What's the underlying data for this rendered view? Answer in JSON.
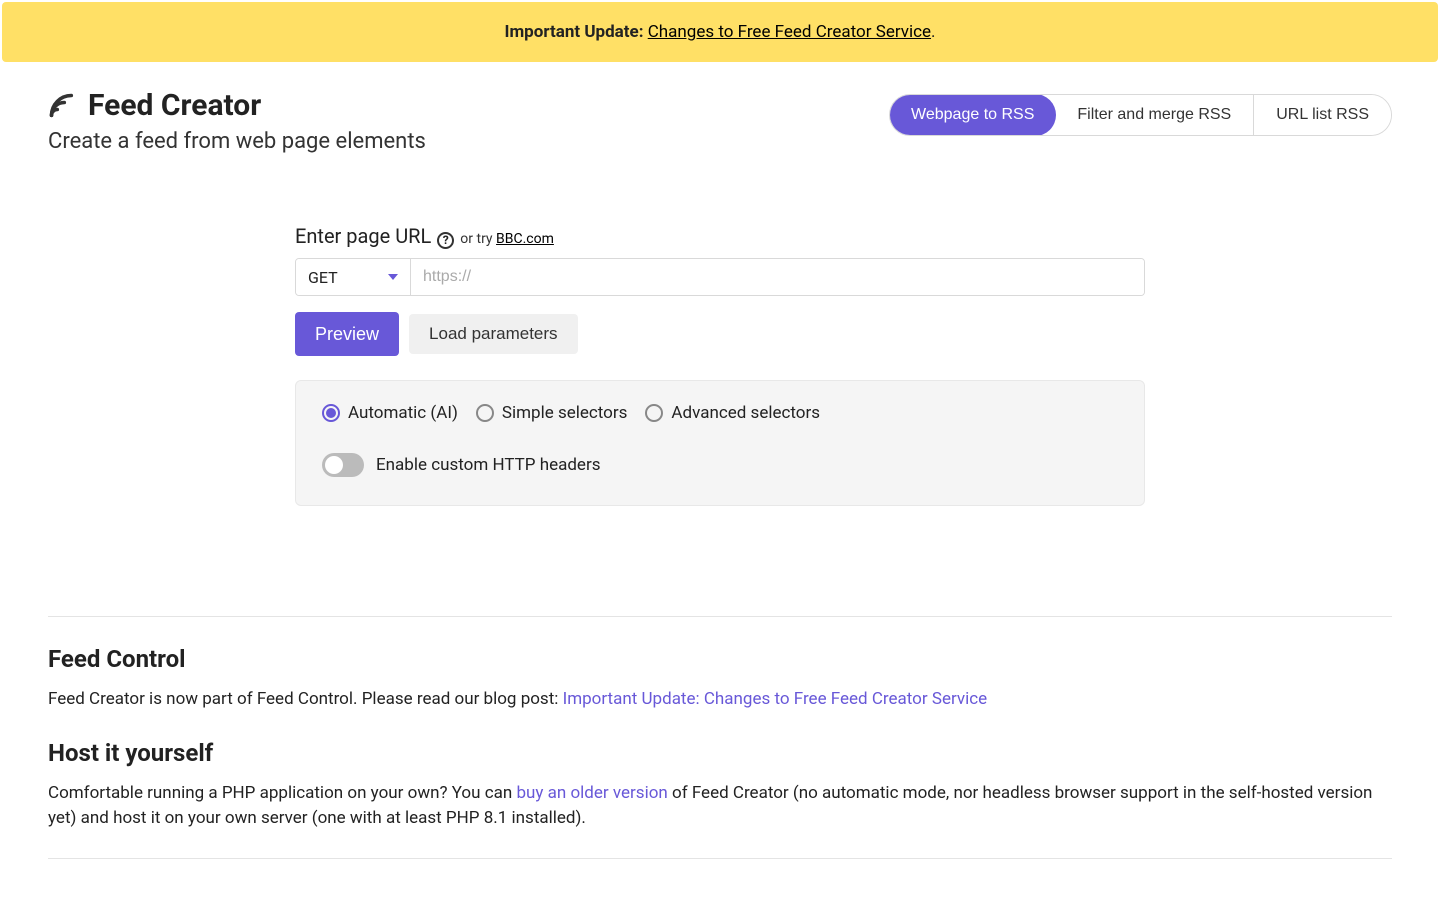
{
  "banner": {
    "prefix": "Important Update:",
    "link_text": "Changes to Free Feed Creator Service",
    "suffix": "."
  },
  "header": {
    "title": "Feed Creator",
    "subtitle": "Create a feed from web page elements"
  },
  "tabs": {
    "items": [
      "Webpage to RSS",
      "Filter and merge RSS",
      "URL list RSS"
    ]
  },
  "form": {
    "label": "Enter page URL",
    "try_prefix": "or try",
    "try_link": "BBC.com",
    "method": "GET",
    "url_placeholder": "https://",
    "url_value": "",
    "preview_btn": "Preview",
    "load_btn": "Load parameters",
    "radios": [
      "Automatic (AI)",
      "Simple selectors",
      "Advanced selectors"
    ],
    "toggle_label": "Enable custom HTTP headers"
  },
  "sections": {
    "feed_control": {
      "heading": "Feed Control",
      "text_before": "Feed Creator is now part of Feed Control. Please read our blog post: ",
      "link": "Important Update: Changes to Free Feed Creator Service"
    },
    "host": {
      "heading": "Host it yourself",
      "text_before": "Comfortable running a PHP application on your own? You can ",
      "link": "buy an older version",
      "text_after": " of Feed Creator (no automatic mode, nor headless browser support in the self-hosted version yet) and host it on your own server (one with at least PHP 8.1 installed)."
    }
  }
}
